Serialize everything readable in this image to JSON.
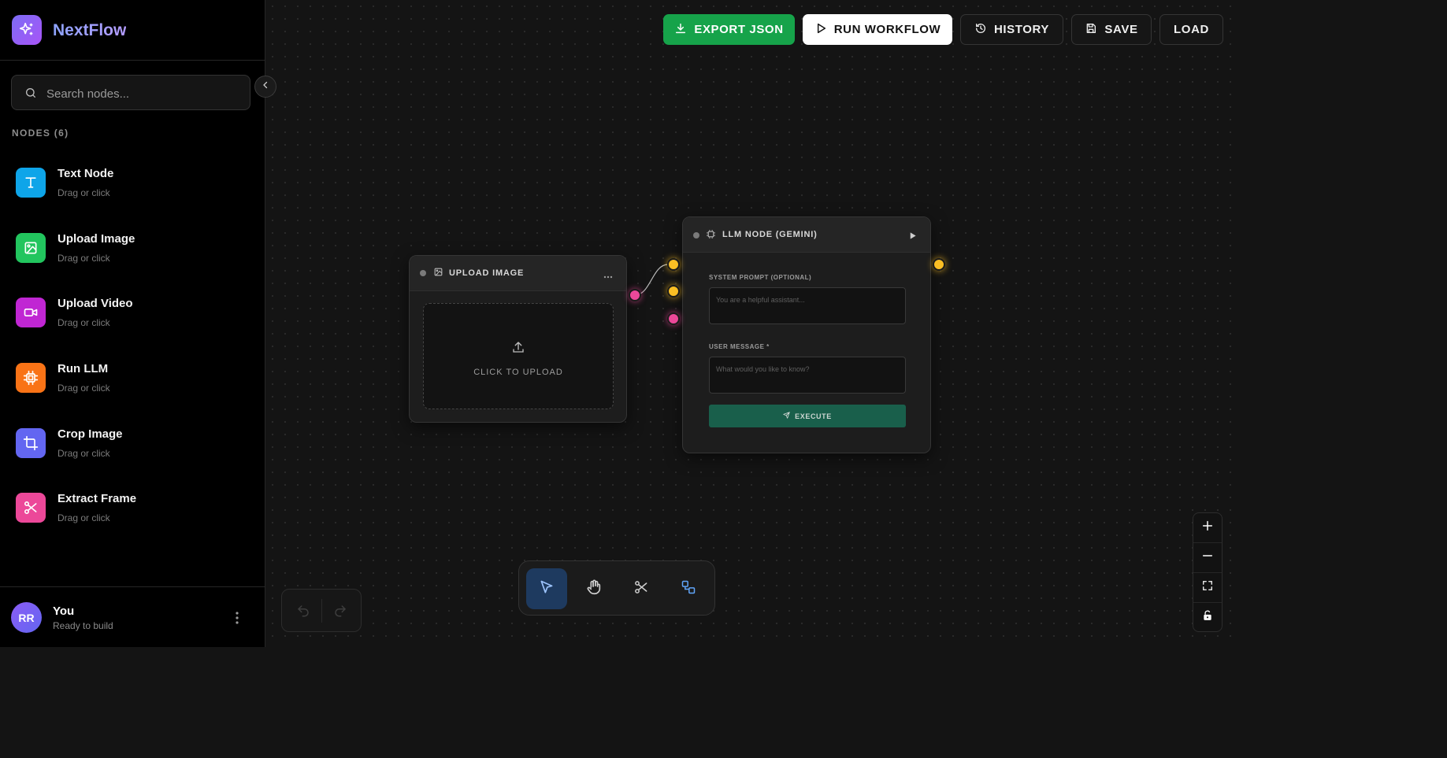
{
  "app": {
    "name": "NextFlow"
  },
  "search": {
    "placeholder": "Search nodes..."
  },
  "nodes_section": {
    "title": "NODES (6)"
  },
  "node_palette": [
    {
      "label": "Text Node",
      "hint": "Drag or click",
      "icon": "text-icon",
      "color": "#0ea5e9"
    },
    {
      "label": "Upload Image",
      "hint": "Drag or click",
      "icon": "image-icon",
      "color": "#22c55e"
    },
    {
      "label": "Upload Video",
      "hint": "Drag or click",
      "icon": "video-icon",
      "color": "#c026d3"
    },
    {
      "label": "Run LLM",
      "hint": "Drag or click",
      "icon": "cpu-icon",
      "color": "#f97316"
    },
    {
      "label": "Crop Image",
      "hint": "Drag or click",
      "icon": "crop-icon",
      "color": "#6366f1"
    },
    {
      "label": "Extract Frame",
      "hint": "Drag or click",
      "icon": "scissors-icon",
      "color": "#ec4899"
    }
  ],
  "user": {
    "initials": "RR",
    "name": "You",
    "status": "Ready to build"
  },
  "toolbar": {
    "export_json": "EXPORT JSON",
    "run_workflow": "RUN WORKFLOW",
    "history": "HISTORY",
    "save": "SAVE",
    "load": "LOAD"
  },
  "upload_node": {
    "title": "UPLOAD IMAGE",
    "upload_text": "CLICK TO UPLOAD"
  },
  "llm_node": {
    "title": "LLM NODE (GEMINI)",
    "system_prompt_label": "SYSTEM PROMPT (OPTIONAL)",
    "system_prompt_placeholder": "You are a helpful assistant...",
    "system_prompt_value": "",
    "user_message_label": "USER MESSAGE *",
    "user_message_placeholder": "What would you like to know?",
    "user_message_value": "",
    "execute_label": "EXECUTE"
  },
  "canvas_tools": {
    "active": "select",
    "items": [
      "select",
      "pan",
      "cut",
      "connect"
    ]
  },
  "colors": {
    "accent_green": "#16a34a",
    "handle_image": "#ec4899",
    "handle_text": "#fbbf24",
    "execute_button": "#195f4b",
    "active_tool": "#1e3a5f"
  }
}
